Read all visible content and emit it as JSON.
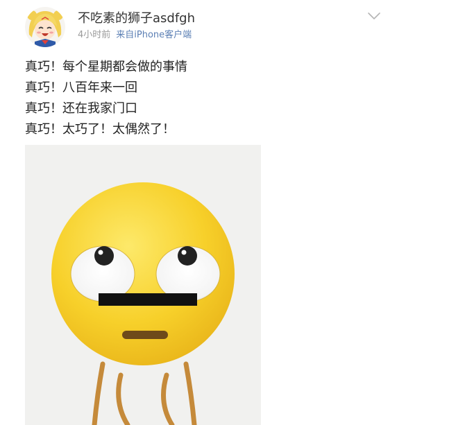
{
  "post": {
    "author": {
      "name": "不吃素的狮子asdfgh",
      "avatar": "anime-girl-avatar"
    },
    "time": "4小时前",
    "source": "来自iPhone客户端",
    "menu_icon": "chevron-down-icon",
    "lines": [
      "真巧！每个星期都会做的事情",
      "真巧！八百年来一回",
      "真巧！还在我家门口",
      "真巧！太巧了！太偶然了！"
    ],
    "image": {
      "subject": "eye-roll-emoji"
    }
  },
  "colors": {
    "text": "#222222",
    "meta": "#9a9a9a",
    "source_link": "#5b7fb4",
    "emoji_yellow": "#f7d02a",
    "image_bg": "#f1f1ef"
  }
}
